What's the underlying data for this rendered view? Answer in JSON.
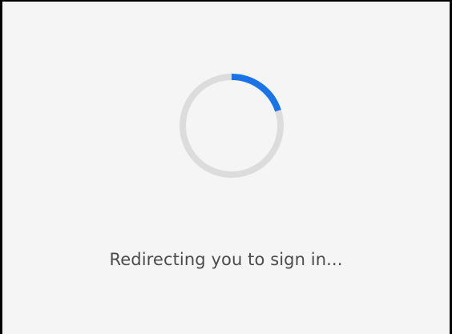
{
  "loading": {
    "message": "Redirecting you to sign in...",
    "progress": 0.2,
    "track_color": "#dcdcdc",
    "fill_color": "#1b73e8",
    "icon": "loading-spinner-icon"
  }
}
